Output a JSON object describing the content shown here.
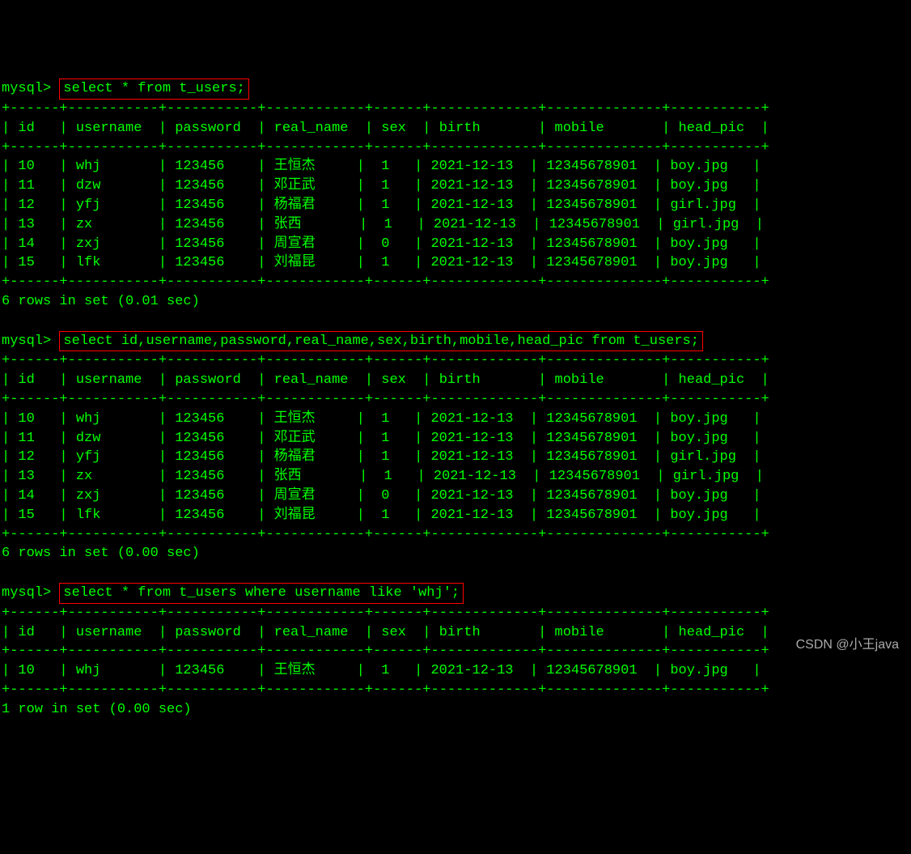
{
  "prompt": "mysql>",
  "queries": [
    {
      "command": "select * from t_users;",
      "result_msg": "6 rows in set (0.01 sec)"
    },
    {
      "command": "select id,username,password,real_name,sex,birth,mobile,head_pic from t_users;",
      "result_msg": "6 rows in set (0.00 sec)"
    },
    {
      "command": "select * from t_users where username like 'whj';",
      "result_msg": "1 row in set (0.00 sec)"
    }
  ],
  "headers": [
    "id",
    "username",
    "password",
    "real_name",
    "sex",
    "birth",
    "mobile",
    "head_pic"
  ],
  "border": "+------+-----------+-----------+------------+------+-------------+--------------+-----------+",
  "header_row": "| id   | username  | password  | real_name  | sex  | birth       | mobile       | head_pic  |",
  "rows_full": [
    "| 10   | whj       | 123456    | 王恒杰     |  1   | 2021-12-13  | 12345678901  | boy.jpg   |",
    "| 11   | dzw       | 123456    | 邓正武     |  1   | 2021-12-13  | 12345678901  | boy.jpg   |",
    "| 12   | yfj       | 123456    | 杨福君     |  1   | 2021-12-13  | 12345678901  | girl.jpg  |",
    "| 13   | zx        | 123456    | 张西       |  1   | 2021-12-13  | 12345678901  | girl.jpg  |",
    "| 14   | zxj       | 123456    | 周宣君     |  0   | 2021-12-13  | 12345678901  | boy.jpg   |",
    "| 15   | lfk       | 123456    | 刘福昆     |  1   | 2021-12-13  | 12345678901  | boy.jpg   |"
  ],
  "rows_single": [
    "| 10   | whj       | 123456    | 王恒杰     |  1   | 2021-12-13  | 12345678901  | boy.jpg   |"
  ],
  "data_records": [
    {
      "id": 10,
      "username": "whj",
      "password": "123456",
      "real_name": "王恒杰",
      "sex": 1,
      "birth": "2021-12-13",
      "mobile": "12345678901",
      "head_pic": "boy.jpg"
    },
    {
      "id": 11,
      "username": "dzw",
      "password": "123456",
      "real_name": "邓正武",
      "sex": 1,
      "birth": "2021-12-13",
      "mobile": "12345678901",
      "head_pic": "boy.jpg"
    },
    {
      "id": 12,
      "username": "yfj",
      "password": "123456",
      "real_name": "杨福君",
      "sex": 1,
      "birth": "2021-12-13",
      "mobile": "12345678901",
      "head_pic": "girl.jpg"
    },
    {
      "id": 13,
      "username": "zx",
      "password": "123456",
      "real_name": "张西",
      "sex": 1,
      "birth": "2021-12-13",
      "mobile": "12345678901",
      "head_pic": "girl.jpg"
    },
    {
      "id": 14,
      "username": "zxj",
      "password": "123456",
      "real_name": "周宣君",
      "sex": 0,
      "birth": "2021-12-13",
      "mobile": "12345678901",
      "head_pic": "boy.jpg"
    },
    {
      "id": 15,
      "username": "lfk",
      "password": "123456",
      "real_name": "刘福昆",
      "sex": 1,
      "birth": "2021-12-13",
      "mobile": "12345678901",
      "head_pic": "boy.jpg"
    }
  ],
  "watermark": "CSDN @小王java"
}
